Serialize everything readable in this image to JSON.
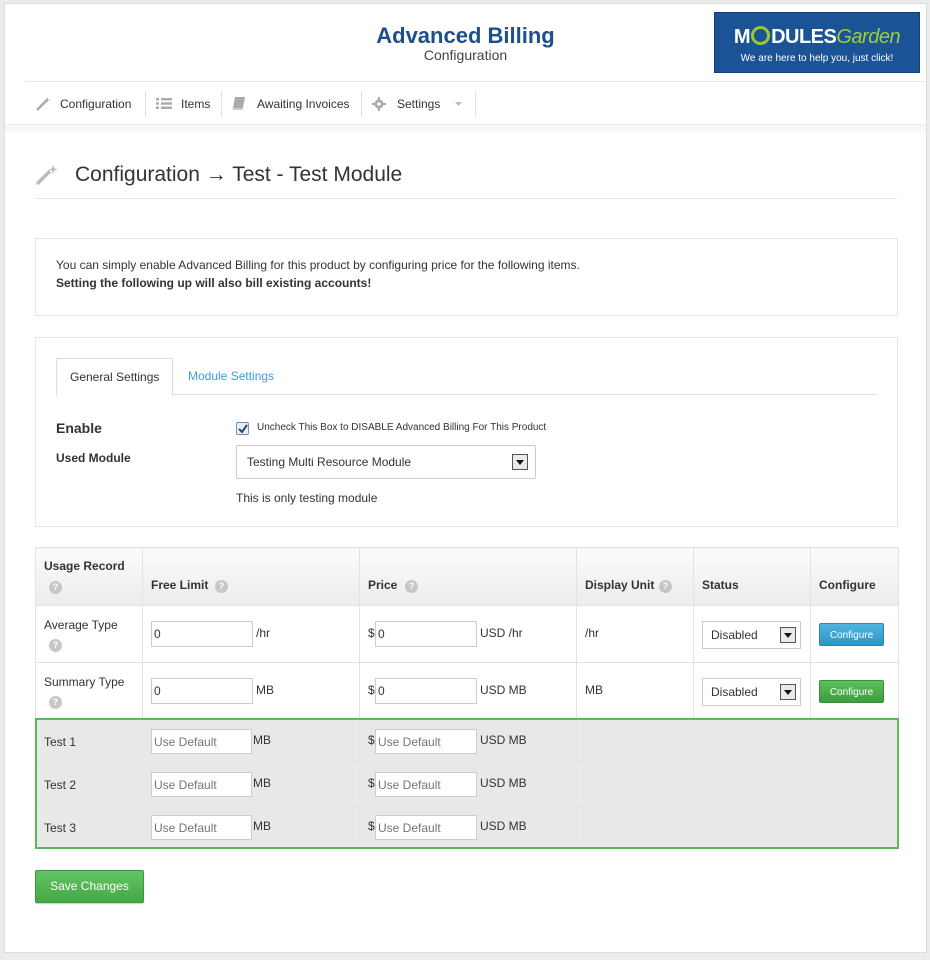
{
  "header": {
    "title": "Advanced Billing",
    "subtitle": "Configuration",
    "logo": {
      "word_pre": "M",
      "word_mid": "DULES",
      "word_post": "Garden",
      "tagline": "We are here to help you, just click!"
    }
  },
  "nav": {
    "items": [
      {
        "label": "Configuration",
        "icon": "magic-wand-icon"
      },
      {
        "label": "Items",
        "icon": "list-icon"
      },
      {
        "label": "Awaiting Invoices",
        "icon": "book-icon"
      },
      {
        "label": "Settings",
        "icon": "gear-icon"
      }
    ]
  },
  "page": {
    "title": "Configuration → Test - Test Module"
  },
  "info": {
    "line1": "You can simply enable Advanced Billing for this product by configuring price for the following items.",
    "line2": "Setting the following up will also bill existing accounts!"
  },
  "settings": {
    "tabs": [
      "General Settings",
      "Module Settings"
    ],
    "enable_label": "Enable",
    "enable_checked": true,
    "enable_checkbox_label": "Uncheck This Box to DISABLE Advanced Billing For This Product",
    "used_module_label": "Used Module",
    "used_module_value": "Testing Multi Resource Module",
    "module_description": "This is only testing module"
  },
  "table": {
    "headers": {
      "usage_record": "Usage Record",
      "free_limit": "Free Limit",
      "price": "Price",
      "display_unit": "Display Unit",
      "status": "Status",
      "configure": "Configure"
    },
    "help_glyph": "?",
    "currency_symbol": "$",
    "rows": [
      {
        "name": "Average Type",
        "free_limit": "0",
        "free_unit": "/hr",
        "price": "0",
        "price_unit": "USD /hr",
        "display_unit": "/hr",
        "status": "Disabled",
        "configure": "Configure"
      },
      {
        "name": "Summary Type",
        "free_limit": "0",
        "free_unit": "MB",
        "price": "0",
        "price_unit": "USD MB",
        "display_unit": "MB",
        "status": "Disabled",
        "configure": "Configure"
      }
    ],
    "test_rows": [
      {
        "name": "Test 1",
        "free_placeholder": "Use Default",
        "free_unit": "MB",
        "price_placeholder": "Use Default",
        "price_unit": "USD MB"
      },
      {
        "name": "Test 2",
        "free_placeholder": "Use Default",
        "free_unit": "MB",
        "price_placeholder": "Use Default",
        "price_unit": "USD MB"
      },
      {
        "name": "Test 3",
        "free_placeholder": "Use Default",
        "free_unit": "MB",
        "price_placeholder": "Use Default",
        "price_unit": "USD MB"
      }
    ]
  },
  "save_label": "Save Changes",
  "colors": {
    "title_blue": "#1f4f8a",
    "link_blue": "#3a9fd6",
    "success_green": "#5cb85c"
  }
}
